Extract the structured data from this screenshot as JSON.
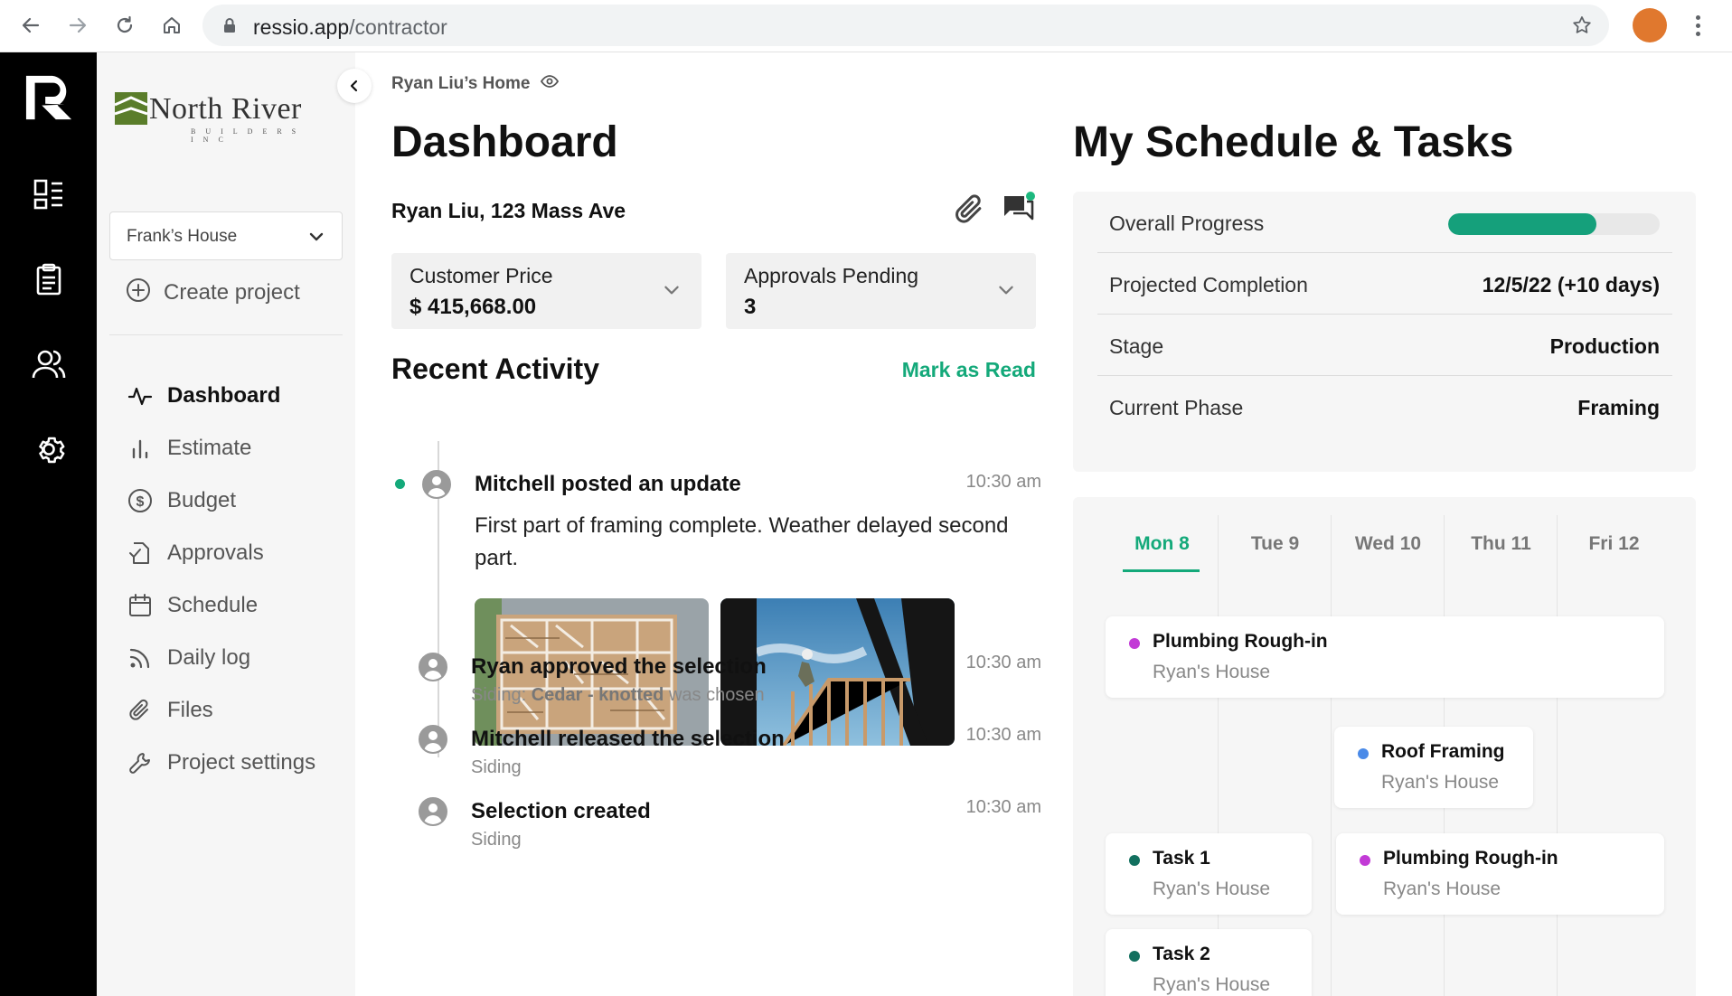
{
  "browser": {
    "url_host": "ressio.app",
    "url_path": "/contractor"
  },
  "sidebar": {
    "brand_name": "North River",
    "brand_sub": "BUILDERS INC",
    "project_select": "Frank’s House",
    "create_project": "Create project",
    "nav": [
      {
        "label": "Dashboard",
        "icon": "activity-icon",
        "active": true
      },
      {
        "label": "Estimate",
        "icon": "bar-chart-icon"
      },
      {
        "label": "Budget",
        "icon": "dollar-icon"
      },
      {
        "label": "Approvals",
        "icon": "approvals-icon"
      },
      {
        "label": "Schedule",
        "icon": "calendar-icon"
      },
      {
        "label": "Daily log",
        "icon": "rss-icon"
      },
      {
        "label": "Files",
        "icon": "paperclip-icon"
      },
      {
        "label": "Project settings",
        "icon": "wrench-icon"
      }
    ]
  },
  "main": {
    "breadcrumb": "Ryan Liu’s Home",
    "title": "Dashboard",
    "client_address": "Ryan Liu, 123 Mass Ave",
    "customer_price_label": "Customer Price",
    "customer_price_value": "$ 415,668.00",
    "approvals_label": "Approvals Pending",
    "approvals_value": "3",
    "recent_activity_title": "Recent Activity",
    "mark_as_read": "Mark as Read",
    "activities": [
      {
        "title": "Mitchell posted an update",
        "time": "10:30 am",
        "body": "First part of framing complete. Weather delayed second part.",
        "unread": true
      },
      {
        "title": "Ryan approved the selection",
        "time": "10:30 am",
        "sub_prefix": "Siding: ",
        "sub_bold": "Cedar - knotted",
        "sub_suffix": " was chosen"
      },
      {
        "title": "Mitchell released the selection",
        "time": "10:30 am",
        "sub": "Siding"
      },
      {
        "title": "Selection created",
        "time": "10:30 am",
        "sub": "Siding"
      }
    ]
  },
  "schedule": {
    "title": "My Schedule & Tasks",
    "overall_progress_label": "Overall Progress",
    "overall_progress_value": 0.7,
    "projected_completion_label": "Projected Completion",
    "projected_completion_value": "12/5/22 (+10 days)",
    "stage_label": "Stage",
    "stage_value": "Production",
    "phase_label": "Current Phase",
    "phase_value": "Framing",
    "days": [
      "Mon 8",
      "Tue 9",
      "Wed 10",
      "Thu 11",
      "Fri 12"
    ],
    "active_day": "Mon 8",
    "tasks": [
      {
        "title": "Plumbing Rough-in",
        "sub": "Ryan's House",
        "color": "#c23ad6"
      },
      {
        "title": "Roof Framing",
        "sub": "Ryan's House",
        "color": "#4a8ae8"
      },
      {
        "title": "Task 1",
        "sub": "Ryan's House",
        "color": "#12705f"
      },
      {
        "title": "Plumbing Rough-in",
        "sub": "Ryan's House",
        "color": "#c23ad6"
      },
      {
        "title": "Task 2",
        "sub": "Ryan's House",
        "color": "#12705f"
      }
    ]
  },
  "colors": {
    "accent": "#14a97a",
    "progress": "#15a07b",
    "rail": "#000000",
    "avatar": "#e0782e"
  }
}
